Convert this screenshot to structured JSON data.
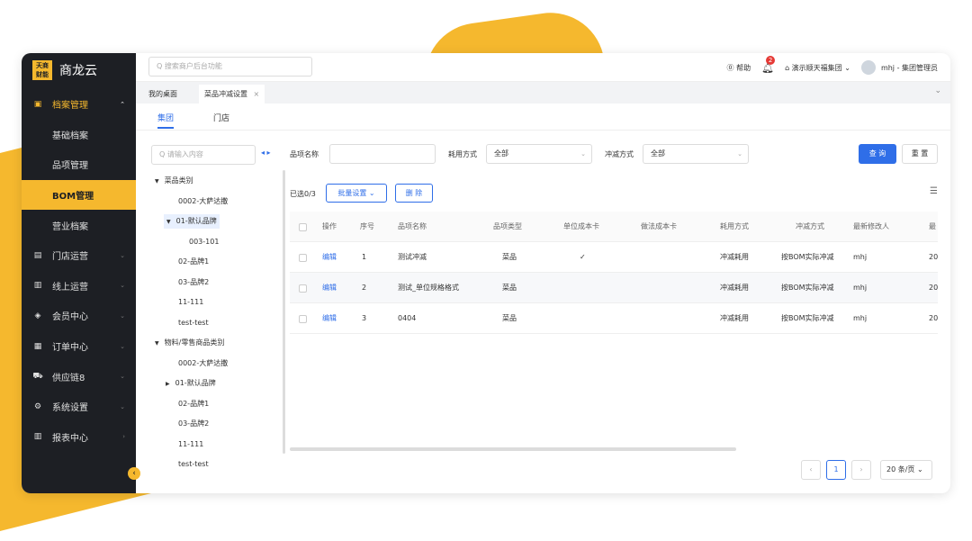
{
  "app": {
    "logo_text": "天商\n财能",
    "logo_line1": "天商",
    "logo_line2": "财能",
    "name": "商龙云"
  },
  "sidebar": {
    "items": [
      {
        "icon": "▣",
        "label": "档案管理",
        "arrow": "⌃"
      },
      {
        "label": "基础档案"
      },
      {
        "label": "品项管理"
      },
      {
        "label": "BOM管理"
      },
      {
        "label": "营业档案"
      },
      {
        "icon": "▤",
        "label": "门店运营",
        "arrow": "⌄"
      },
      {
        "icon": "▥",
        "label": "线上运营",
        "arrow": "⌄"
      },
      {
        "icon": "◈",
        "label": "会员中心",
        "arrow": "⌄"
      },
      {
        "icon": "▦",
        "label": "订单中心",
        "arrow": "⌄"
      },
      {
        "icon": "⛟",
        "label": "供应链8",
        "arrow": "⌄"
      },
      {
        "icon": "⚙",
        "label": "系统设置",
        "arrow": "⌄"
      },
      {
        "icon": "▥",
        "label": "报表中心",
        "arrow": "›"
      }
    ],
    "collapse_glyph": "‹"
  },
  "topbar": {
    "search_placeholder": "Q 搜索商户后台功能",
    "help": "⓪ 帮助",
    "bell_badge": "2",
    "org": "⌂ 演示顺天福集团 ⌄",
    "user": "mhj - 集团管理员"
  },
  "tabs": [
    {
      "label": "我的桌面"
    },
    {
      "label": "菜品冲减设置",
      "close": "×"
    }
  ],
  "tabbar_arrow": "⌄",
  "subtabs": [
    {
      "label": "集团"
    },
    {
      "label": "门店"
    }
  ],
  "tree": {
    "search_placeholder": "Q 请输入内容",
    "arrows": "◂ ▸",
    "nodes": [
      {
        "caret": "▼",
        "label": "菜品类别",
        "depth": 0
      },
      {
        "label": "0002-大萨达撒",
        "depth": 1
      },
      {
        "caret": "▼",
        "label": "01-默认品牌",
        "depth": 1,
        "selected": true
      },
      {
        "label": "003-101",
        "depth": 2
      },
      {
        "label": "02-品牌1",
        "depth": 1
      },
      {
        "label": "03-品牌2",
        "depth": 1
      },
      {
        "label": "11-111",
        "depth": 1
      },
      {
        "label": "test-test",
        "depth": 1
      },
      {
        "caret": "▼",
        "label": "物料/零售商品类别",
        "depth": 0
      },
      {
        "label": "0002-大萨达撒",
        "depth": 1
      },
      {
        "caret": "▶",
        "label": "01-默认品牌",
        "depth": 1
      },
      {
        "label": "02-品牌1",
        "depth": 1
      },
      {
        "label": "03-品牌2",
        "depth": 1
      },
      {
        "label": "11-111",
        "depth": 1
      },
      {
        "label": "test-test",
        "depth": 1
      }
    ]
  },
  "filters": {
    "item_name_label": "品项名称",
    "consume_label": "耗用方式",
    "consume_value": "全部",
    "offset_label": "冲减方式",
    "offset_value": "全部",
    "query_btn": "查 询",
    "reset_btn": "重 置",
    "chevron": "⌄"
  },
  "actions": {
    "selected_count": "已选0/3",
    "batch_btn": "批量设置 ⌄",
    "delete_btn": "删 除",
    "col_setting_glyph": "☰"
  },
  "table": {
    "columns": [
      "操作",
      "序号",
      "品项名称",
      "品项类型",
      "单位成本卡",
      "做法成本卡",
      "耗用方式",
      "冲减方式",
      "最新修改人",
      "最"
    ],
    "rows": [
      {
        "op": "编辑",
        "no": "1",
        "name": "测试冲减",
        "type": "菜品",
        "unit_card": "✓",
        "method_card": "",
        "consume": "冲减耗用",
        "offset": "按BOM实际冲减",
        "modifier": "mhj",
        "more": "20"
      },
      {
        "op": "编辑",
        "no": "2",
        "name": "测试_单位规格格式",
        "type": "菜品",
        "unit_card": "",
        "method_card": "",
        "consume": "冲减耗用",
        "offset": "按BOM实际冲减",
        "modifier": "mhj",
        "more": "20"
      },
      {
        "op": "编辑",
        "no": "3",
        "name": "0404",
        "type": "菜品",
        "unit_card": "",
        "method_card": "",
        "consume": "冲减耗用",
        "offset": "按BOM实际冲减",
        "modifier": "mhj",
        "more": "20"
      }
    ]
  },
  "pager": {
    "prev": "‹",
    "current": "1",
    "next": "›",
    "size": "20 条/页 ⌄"
  },
  "colors": {
    "accent": "#f5b82e",
    "primary": "#2f6ee8",
    "sidebar_bg": "#1d1f24"
  }
}
